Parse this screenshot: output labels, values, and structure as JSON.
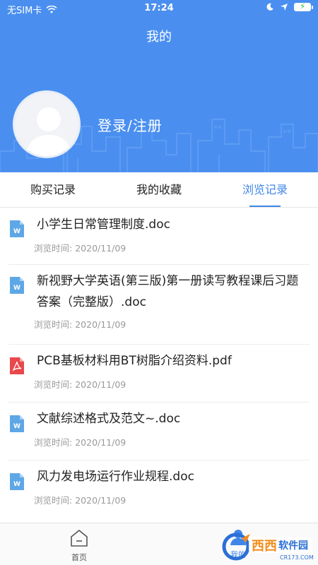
{
  "status_bar": {
    "carrier": "无SIM卡",
    "time": "17:24",
    "icons": [
      "wifi-icon",
      "moon-icon",
      "location-icon",
      "battery-charging-icon"
    ]
  },
  "header": {
    "title": "我的",
    "login_label": "登录/注册",
    "avatar_icon": "default-avatar-icon"
  },
  "tabs": [
    {
      "label": "购买记录",
      "active": false
    },
    {
      "label": "我的收藏",
      "active": false
    },
    {
      "label": "浏览记录",
      "active": true
    }
  ],
  "history": {
    "time_label": "浏览时间:",
    "items": [
      {
        "title": "小学生日常管理制度.doc",
        "type": "doc",
        "date": "2020/11/09"
      },
      {
        "title": "新视野大学英语(第三版)第一册读写教程课后习题答案（完整版）.doc",
        "type": "doc",
        "date": "2020/11/09"
      },
      {
        "title": "PCB基板材料用BT树脂介绍资料.pdf",
        "type": "pdf",
        "date": "2020/11/09"
      },
      {
        "title": "文献综述格式及范文~.doc",
        "type": "doc",
        "date": "2020/11/09"
      },
      {
        "title": "风力发电场运行作业规程.doc",
        "type": "doc",
        "date": "2020/11/09"
      }
    ]
  },
  "bottom_nav": {
    "home_label": "首页",
    "mine_label": "我的"
  },
  "watermark": {
    "brand": "西西软件园",
    "site": "CR173.COM"
  },
  "colors": {
    "primary": "#4a8ff0",
    "tab_active": "#3f86e8",
    "doc_icon": "#5ea7e6",
    "pdf_icon": "#e8484b"
  }
}
